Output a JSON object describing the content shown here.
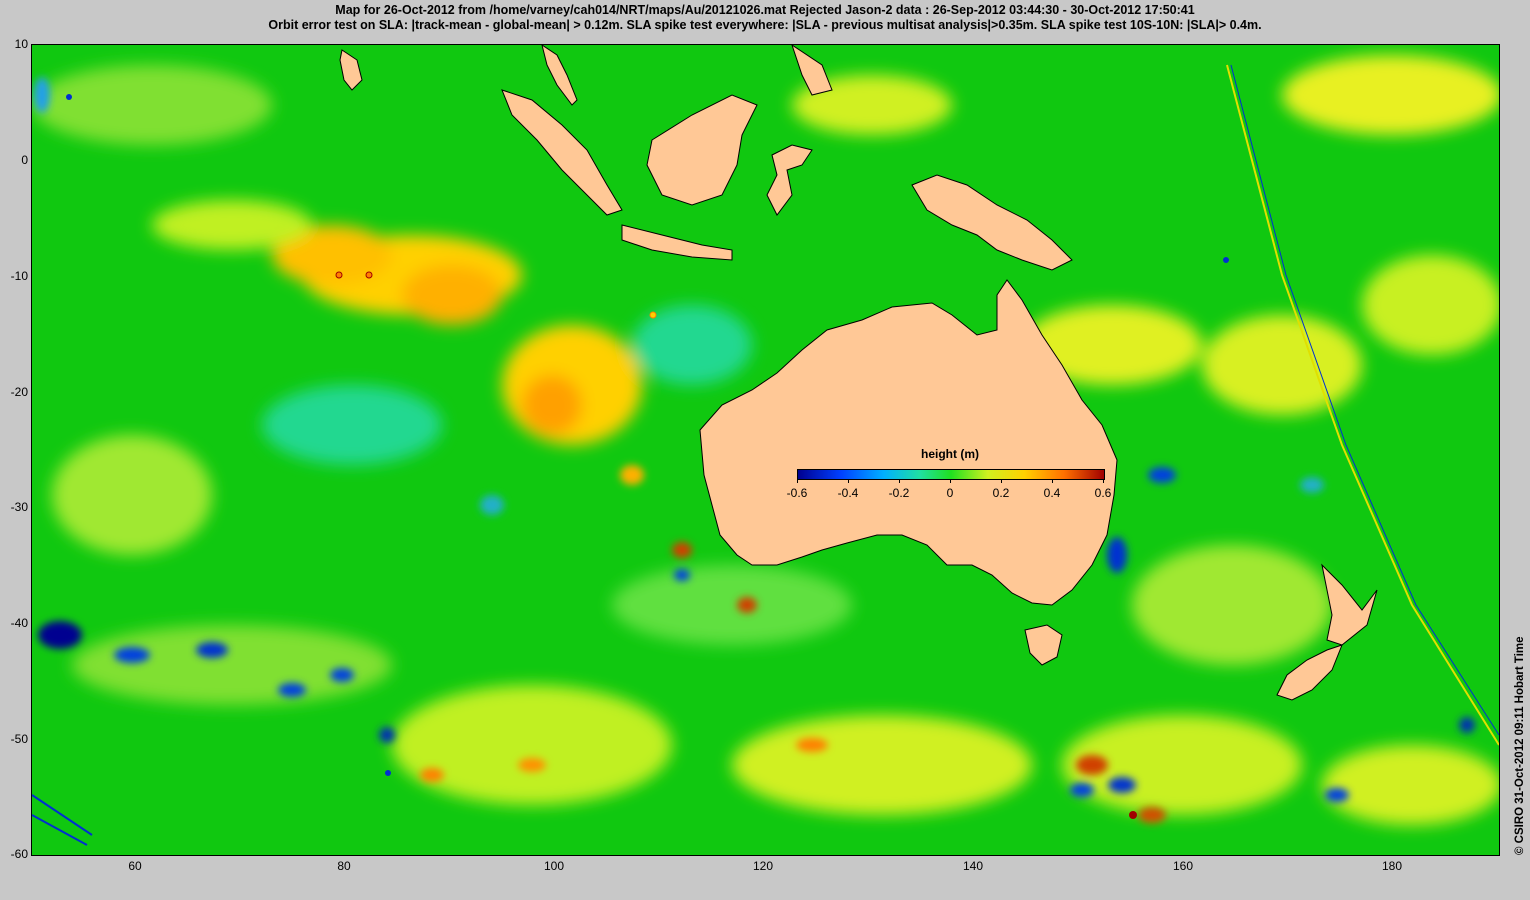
{
  "title": {
    "line1": "Map for 26-Oct-2012 from /home/varney/cah014/NRT/maps/Au/20121026.mat  Rejected Jason-2 data : 26-Sep-2012 03:44:30 - 30-Oct-2012 17:50:41",
    "line2": "Orbit error test on SLA: |track-mean  - global-mean| > 0.12m.  SLA spike test everywhere: |SLA - previous multisat analysis|>0.35m. SLA spike test 10S-10N: |SLA|> 0.4m."
  },
  "axes": {
    "x_ticks": [
      "60",
      "80",
      "100",
      "120",
      "140",
      "160",
      "180"
    ],
    "y_ticks": [
      "10",
      "0",
      "-10",
      "-20",
      "-30",
      "-40",
      "-50",
      "-60"
    ],
    "x_range": [
      50,
      190
    ],
    "y_range": [
      -60,
      10
    ]
  },
  "colorbar": {
    "title": "height (m)",
    "ticks": [
      "-0.6",
      "-0.4",
      "-0.2",
      "0",
      "0.2",
      "0.4",
      "0.6"
    ],
    "range": [
      -0.6,
      0.6
    ]
  },
  "credit": "© CSIRO 31-Oct-2012 09:11 Hobart Time",
  "colors": {
    "land": "#ffc896",
    "ocean_zero": "#10c810",
    "positive_high": "#ffd000",
    "positive_extreme": "#d02000",
    "negative_low": "#20b0c8",
    "negative_extreme": "#0010a0",
    "background": "#c8c8c8"
  }
}
